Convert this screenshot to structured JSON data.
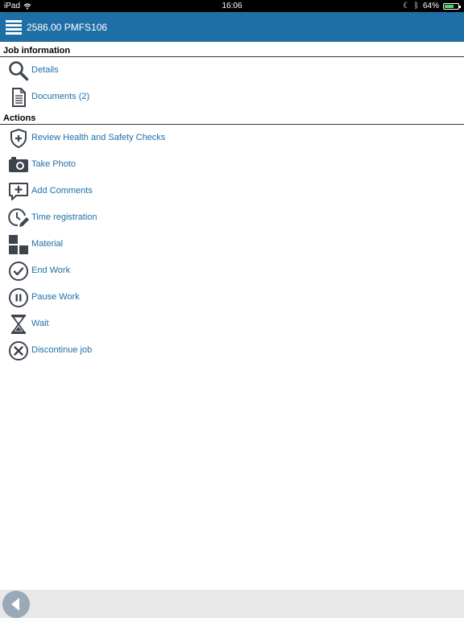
{
  "status_bar": {
    "carrier": "iPad",
    "time": "16:06",
    "battery": "64%",
    "battery_level": 0.64
  },
  "header": {
    "title": "2586.00 PMFS106",
    "menu_icon": "hamburger-menu-icon"
  },
  "sections": [
    {
      "title": "Job information",
      "items": [
        {
          "label": "Details",
          "icon": "magnifier-icon"
        },
        {
          "label": "Documents (2)",
          "icon": "document-icon"
        }
      ]
    },
    {
      "title": "Actions",
      "items": [
        {
          "label": "Review Health and Safety Checks",
          "icon": "shield-plus-icon"
        },
        {
          "label": "Take Photo",
          "icon": "camera-icon"
        },
        {
          "label": "Add Comments",
          "icon": "comment-plus-icon"
        },
        {
          "label": "Time registration",
          "icon": "clock-pencil-icon"
        },
        {
          "label": "Material",
          "icon": "blocks-icon"
        },
        {
          "label": "End Work",
          "icon": "check-circle-icon"
        },
        {
          "label": "Pause Work",
          "icon": "pause-circle-icon"
        },
        {
          "label": "Wait",
          "icon": "hourglass-icon"
        },
        {
          "label": "Discontinue job",
          "icon": "x-circle-icon"
        }
      ]
    }
  ],
  "footer": {
    "back_icon": "back-arrow-icon"
  },
  "colors": {
    "header_bg": "#1f6fa7",
    "link": "#1f6fa7",
    "icon": "#3d4450",
    "footer_bg": "#e8e8e8",
    "back_button": "#9aa9b8"
  }
}
